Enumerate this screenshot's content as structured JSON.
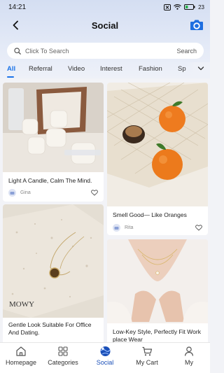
{
  "status_bar": {
    "time": "14:21",
    "battery": "23"
  },
  "header": {
    "title": "Social",
    "back_icon": "chevron-left-icon",
    "camera_icon": "camera-icon"
  },
  "search": {
    "placeholder": "Click To Search",
    "button_label": "Search"
  },
  "tabs": [
    {
      "label": "All",
      "active": true
    },
    {
      "label": "Referral",
      "active": false
    },
    {
      "label": "Video",
      "active": false
    },
    {
      "label": "Interest",
      "active": false
    },
    {
      "label": "Fashion",
      "active": false
    },
    {
      "label": "Sp",
      "active": false
    }
  ],
  "feed": {
    "left": [
      {
        "caption": "Light A Candle, Calm The Mind.",
        "author": "Gina"
      },
      {
        "caption": "Gentle Look Suitable For Office And Dating.",
        "author": "",
        "image_text": "MOWY"
      }
    ],
    "right": [
      {
        "caption": "Smell Good— Like Oranges",
        "author": "Rita"
      },
      {
        "caption": "Low-Key Style, Perfectly Fit Work place Wear",
        "author": ""
      }
    ]
  },
  "navbar": [
    {
      "label": "Homepage",
      "icon": "home-icon",
      "active": false
    },
    {
      "label": "Categories",
      "icon": "categories-icon",
      "active": false
    },
    {
      "label": "Social",
      "icon": "social-globe-icon",
      "active": true
    },
    {
      "label": "My Cart",
      "icon": "cart-icon",
      "active": false
    },
    {
      "label": "My",
      "icon": "user-icon",
      "active": false
    }
  ],
  "colors": {
    "accent": "#1a73e8",
    "nav_active": "#1a4fb8",
    "camera": "#1f6fe0"
  }
}
